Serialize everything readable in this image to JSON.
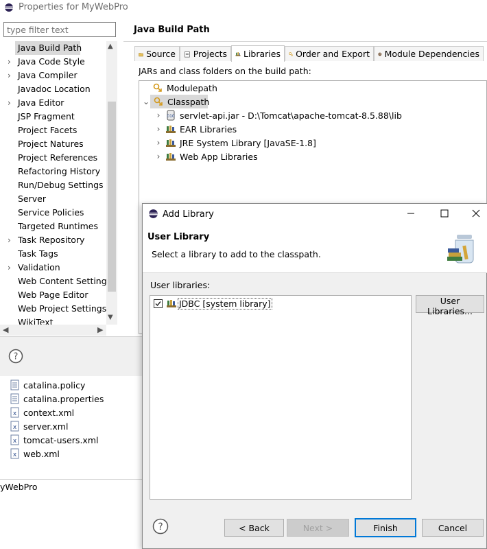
{
  "properties_window": {
    "title": "Properties for MyWebPro",
    "filter_placeholder": "type filter text",
    "nav_items": [
      {
        "label": "Java Build Path",
        "expandable": false,
        "selected": true
      },
      {
        "label": "Java Code Style",
        "expandable": true
      },
      {
        "label": "Java Compiler",
        "expandable": true
      },
      {
        "label": "Javadoc Location",
        "expandable": false
      },
      {
        "label": "Java Editor",
        "expandable": true
      },
      {
        "label": "JSP Fragment",
        "expandable": false
      },
      {
        "label": "Project Facets",
        "expandable": false
      },
      {
        "label": "Project Natures",
        "expandable": false
      },
      {
        "label": "Project References",
        "expandable": false
      },
      {
        "label": "Refactoring History",
        "expandable": false
      },
      {
        "label": "Run/Debug Settings",
        "expandable": false
      },
      {
        "label": "Server",
        "expandable": false
      },
      {
        "label": "Service Policies",
        "expandable": false
      },
      {
        "label": "Targeted Runtimes",
        "expandable": false
      },
      {
        "label": "Task Repository",
        "expandable": true
      },
      {
        "label": "Task Tags",
        "expandable": false
      },
      {
        "label": "Validation",
        "expandable": true
      },
      {
        "label": "Web Content Settings",
        "expandable": false
      },
      {
        "label": "Web Page Editor",
        "expandable": false
      },
      {
        "label": "Web Project Settings",
        "expandable": false
      },
      {
        "label": "WikiText",
        "expandable": false
      }
    ],
    "page_title": "Java Build Path",
    "tabs": [
      {
        "label": "Source",
        "icon": "source-icon"
      },
      {
        "label": "Projects",
        "icon": "projects-icon"
      },
      {
        "label": "Libraries",
        "icon": "libraries-icon",
        "active": true
      },
      {
        "label": "Order and Export",
        "icon": "order-export-icon"
      },
      {
        "label": "Module Dependencies",
        "icon": "module-dependencies-icon"
      }
    ],
    "jars_label": "JARs and class folders on the build path:",
    "tree": {
      "modulepath": "Modulepath",
      "classpath": "Classpath",
      "children": [
        "servlet-api.jar - D:\\Tomcat\\apache-tomcat-8.5.88\\lib",
        "EAR Libraries",
        "JRE System Library [JavaSE-1.8]",
        "Web App Libraries"
      ]
    }
  },
  "background_files": [
    "catalina.policy",
    "catalina.properties",
    "context.xml",
    "server.xml",
    "tomcat-users.xml",
    "web.xml"
  ],
  "status_text": "yWebPro",
  "add_library_dialog": {
    "title": "Add Library",
    "heading": "User Library",
    "description": "Select a library to add to the classpath.",
    "user_libraries_label": "User libraries:",
    "libraries": [
      {
        "label": "JDBC [system library]",
        "checked": true
      }
    ],
    "user_libraries_button": "User Libraries...",
    "back_button": "< Back",
    "next_button": "Next >",
    "finish_button": "Finish",
    "cancel_button": "Cancel"
  },
  "colors": {
    "accent": "#0078d7",
    "selection": "#d9d9d9",
    "dialog_bg": "#f0f0f0"
  }
}
